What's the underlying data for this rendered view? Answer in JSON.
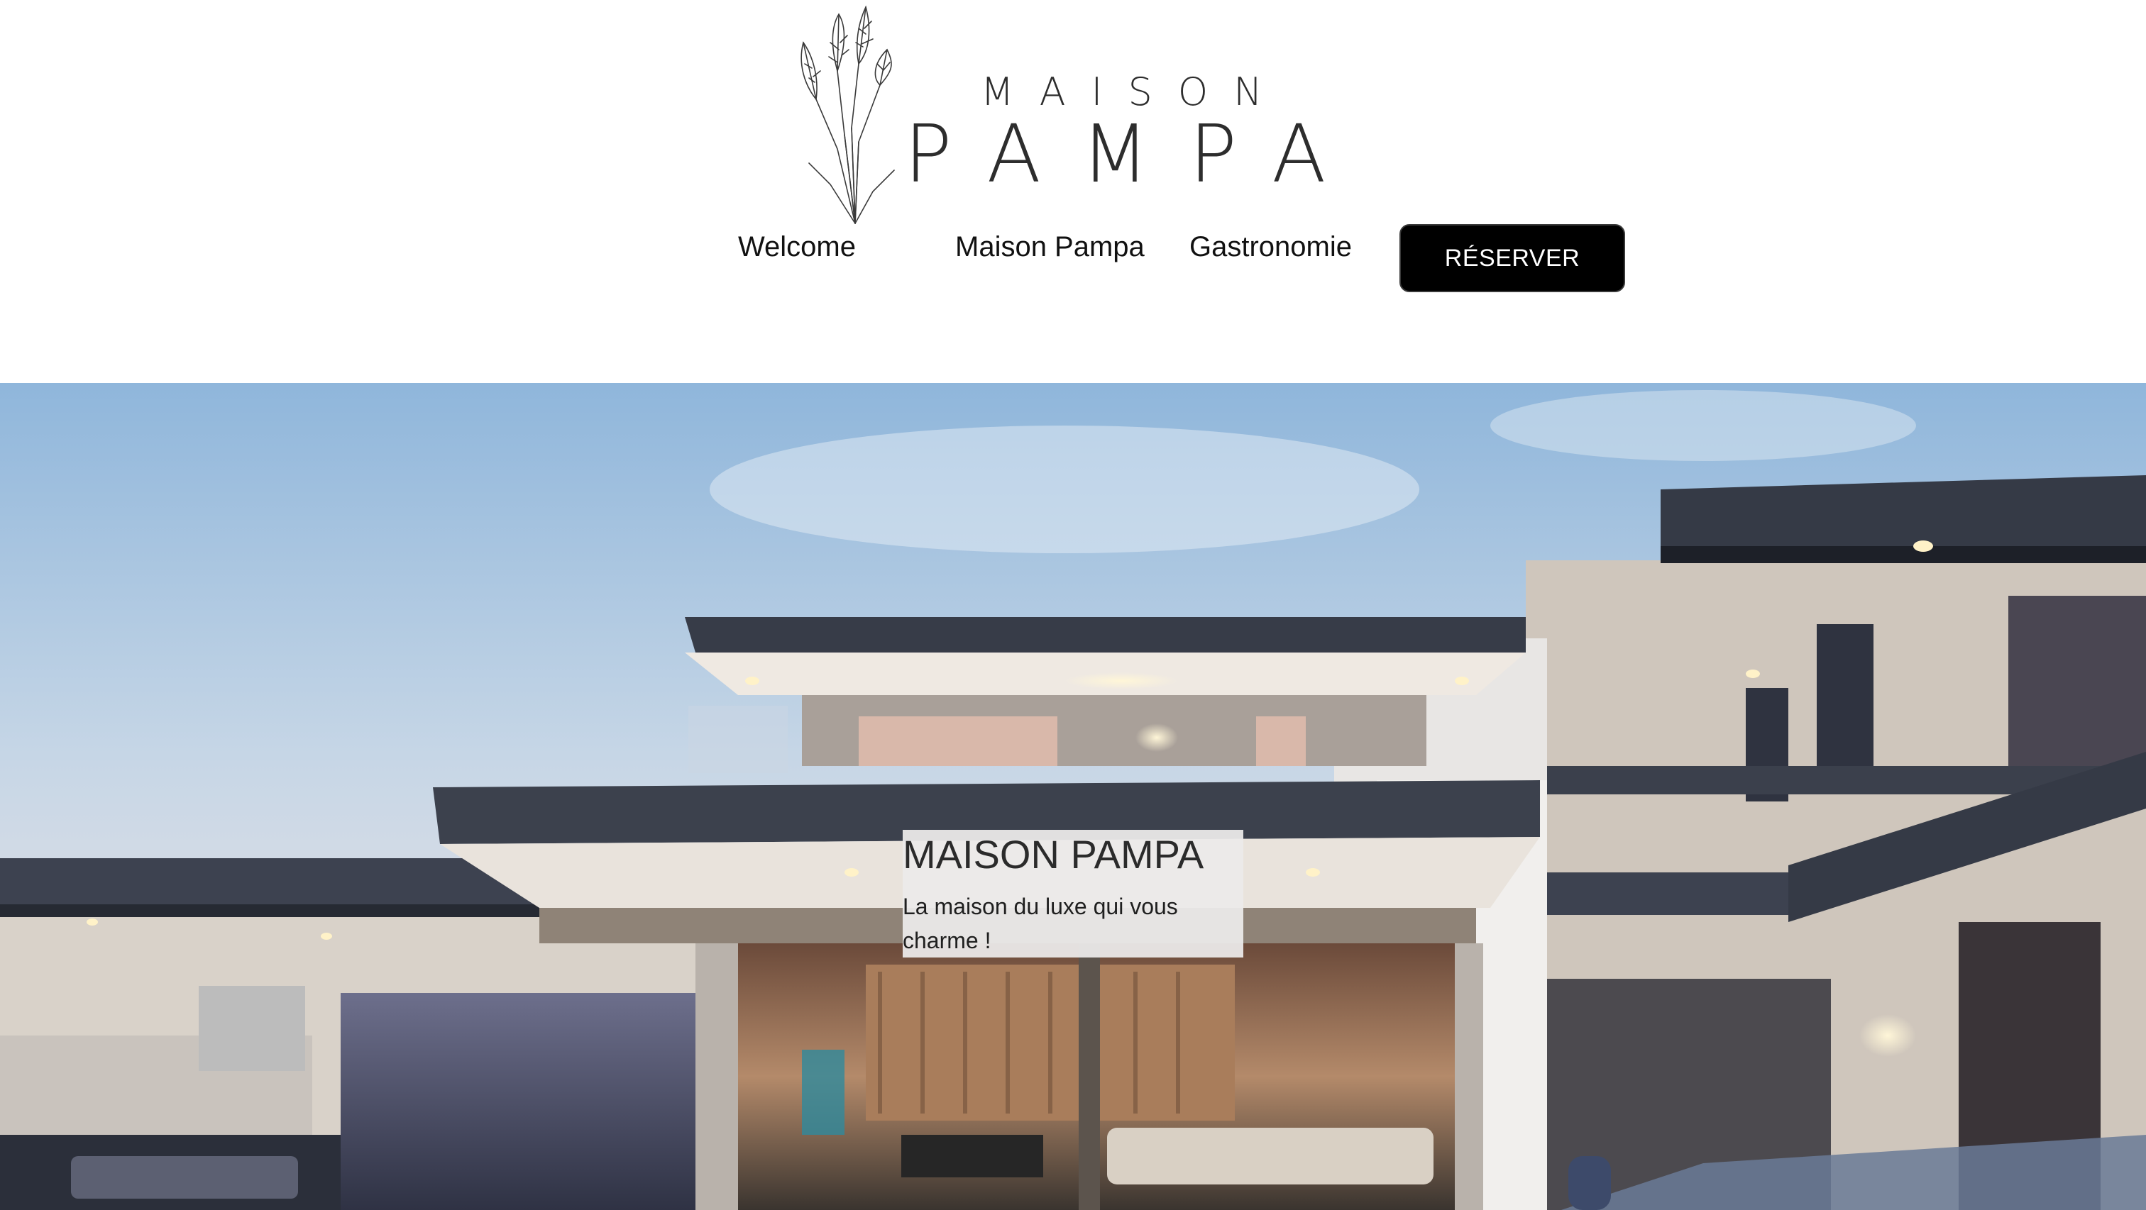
{
  "brand": {
    "logo_top": "MAISON",
    "logo_bottom": "PAMPA"
  },
  "nav": {
    "items": [
      {
        "label": "Welcome"
      },
      {
        "label": "Maison Pampa"
      },
      {
        "label": "Gastronomie"
      }
    ],
    "cta_label": "RÉSERVER"
  },
  "hero": {
    "title": "MAISON PAMPA",
    "subtitle": "La maison du luxe qui vous charme !"
  },
  "colors": {
    "cta_background": "#000000",
    "cta_text": "#ffffff",
    "card_background": "#ecebeb"
  },
  "icons": {
    "logo_illustration": "pampas-grass-bouquet"
  }
}
